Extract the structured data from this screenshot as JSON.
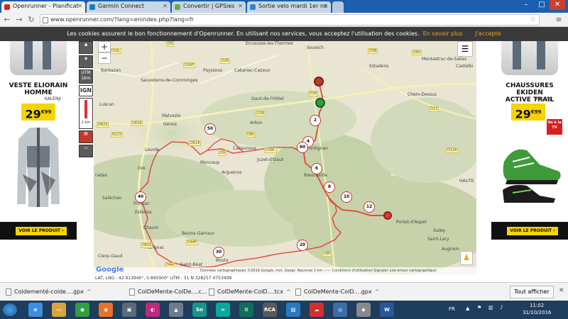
{
  "browser": {
    "tabs": [
      {
        "title": "Openrunner - Planificat",
        "active": true,
        "color": "#d9231b"
      },
      {
        "title": "Garmin Connect",
        "active": false,
        "color": "#1a7ac9"
      },
      {
        "title": "Convertir | GPSies",
        "active": false,
        "color": "#6aa84f"
      },
      {
        "title": "Sortie velo mardi 1er no",
        "active": false,
        "color": "#3b7fd6"
      }
    ],
    "url": "www.openrunner.com/?lang=enindex.php?lang=fr"
  },
  "cookie_bar": {
    "text": "Les cookies assurent le bon fonctionnement d'Openrunner. En utilisant nos services, vous acceptez l'utilisation des cookies.",
    "more_link": "En savoir plus",
    "accept_link": "J'accepte"
  },
  "ads": {
    "left": {
      "title_line1": "VESTE ELIORAIN",
      "title_line2": "HOMME",
      "brand": "KALENJI",
      "price_main": "29",
      "price_cents": "€99",
      "cta": "VOIR LE PRODUIT"
    },
    "right": {
      "title_line1": "CHAUSSURES EKIDEN",
      "title_line2": "ACTIVE TRAIL",
      "brand": "KALENJI",
      "price_main": "29",
      "price_cents": "€99",
      "tv_badge": "Vu à la TV",
      "cta": "VOIR LE PRODUIT"
    }
  },
  "map_tools": {
    "utm": "UTM 1km",
    "ign": "IGN",
    "scale": "2 km"
  },
  "map": {
    "zoom_in": "+",
    "zoom_out": "−",
    "places": [
      {
        "name": "Encausse-les-Thermes"
      },
      {
        "name": "Soueich"
      },
      {
        "name": "Barbazan"
      },
      {
        "name": "Sauveterre-de-Comminges"
      },
      {
        "name": "Payssous"
      },
      {
        "name": "Cabanac-Cazaux"
      },
      {
        "name": "Estadens"
      },
      {
        "name": "Montastruc-de-Salies"
      },
      {
        "name": "Castelbi"
      },
      {
        "name": "Luscan"
      },
      {
        "name": "Izaut-de-l'Hôtel"
      },
      {
        "name": "Chein-Dessus"
      },
      {
        "name": "Malvezie"
      },
      {
        "name": "Génos"
      },
      {
        "name": "Arbon"
      },
      {
        "name": "Lourde"
      },
      {
        "name": "Cazaunous"
      },
      {
        "name": "Juzet-d'Izaut"
      },
      {
        "name": "Moncaup"
      },
      {
        "name": "Arguenos"
      },
      {
        "name": "Ore"
      },
      {
        "name": "Frontignan"
      },
      {
        "name": "Rieucueille"
      },
      {
        "name": "radan"
      },
      {
        "name": "Saléchan"
      },
      {
        "name": "Fronsac"
      },
      {
        "name": "Estenos"
      },
      {
        "name": "Portet-d'Aspet"
      },
      {
        "name": "Chaum"
      },
      {
        "name": "Bezins-Garraux"
      },
      {
        "name": "Galey"
      },
      {
        "name": "Saint-Lary"
      },
      {
        "name": "Augirein"
      },
      {
        "name": "Marignac"
      },
      {
        "name": "Saint-Béat"
      },
      {
        "name": "Boutx"
      },
      {
        "name": "Cierp-Gaud"
      },
      {
        "name": "HAUTE"
      }
    ],
    "roads": [
      "D33L",
      "D9",
      "D26F",
      "D26",
      "D5B",
      "D60",
      "D34",
      "D39",
      "D13",
      "D618",
      "D825",
      "D44F",
      "D85",
      "N125",
      "D618",
      "D39C",
      "D9",
      "D13A",
      "D44",
      "D618",
      "D85"
    ],
    "km_markers": [
      "2",
      "4",
      "6",
      "8",
      "10",
      "12",
      "20",
      "30",
      "40",
      "50",
      "60"
    ],
    "attribution": "Données cartographiques ©2016 Google, Inst. Geogr. Nacional   2 km ——   Conditions d'utilisation   Signaler une erreur cartographique",
    "google": "Google",
    "coords": "LAT, LNG : 42.913940°, 0.895900°   UTM : 31 N 328257 4753408"
  },
  "downloads": [
    {
      "name": "Coldementé-colde....gpx"
    },
    {
      "name": "ColDeMente-ColDe....c..."
    },
    {
      "name": "ColDeMente-ColD....tcx"
    },
    {
      "name": "ColDeMente-ColD....gpx"
    }
  ],
  "show_all": "Tout afficher",
  "taskbar": {
    "apps": [
      {
        "label": "e",
        "color": "#3b8ee0"
      },
      {
        "label": "▭",
        "color": "#d9a441"
      },
      {
        "label": "◉",
        "color": "#2f9e44"
      },
      {
        "label": "◉",
        "color": "#e8712c"
      },
      {
        "label": "▣",
        "color": "#5a6b7a"
      },
      {
        "label": "◐",
        "color": "#c0287c"
      },
      {
        "label": "▲",
        "color": "#6c7c8c"
      },
      {
        "label": "Sn",
        "color": "#14968a"
      },
      {
        "label": "∞",
        "color": "#0aa7a0"
      },
      {
        "label": "⚙",
        "color": "#0f6f5c"
      },
      {
        "label": "RCA",
        "color": "#5a5a5a"
      },
      {
        "label": "▨",
        "color": "#2b7bbd"
      },
      {
        "label": "☁",
        "color": "#d32f2f"
      },
      {
        "label": "◎",
        "color": "#3a6ea5"
      },
      {
        "label": "◆",
        "color": "#8a8a8a"
      },
      {
        "label": "W",
        "color": "#2b579a"
      }
    ],
    "lang": "FR",
    "time": "11:02",
    "date": "31/10/2016"
  }
}
